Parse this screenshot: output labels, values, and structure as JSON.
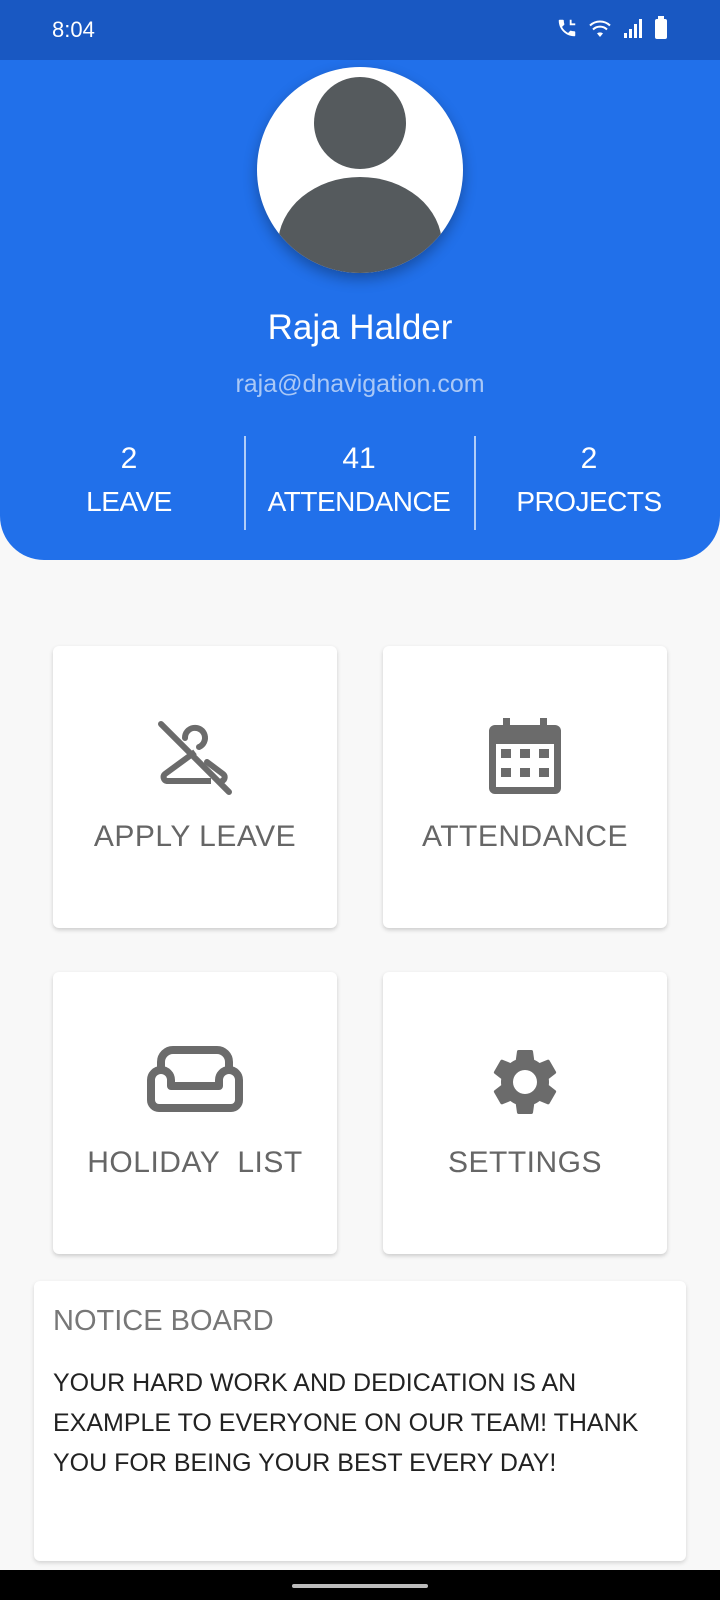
{
  "status_bar": {
    "time": "8:04",
    "icons": [
      "call-icon",
      "wifi-icon",
      "signal-icon",
      "battery-icon"
    ]
  },
  "profile": {
    "name": "Raja Halder",
    "email": "raja@dnavigation.com",
    "avatar_icon": "person-icon"
  },
  "stats": [
    {
      "value": "2",
      "label": "LEAVE"
    },
    {
      "value": "41",
      "label": "ATTENDANCE"
    },
    {
      "value": "2",
      "label": "PROJECTS"
    }
  ],
  "menu": {
    "apply_leave": {
      "label": "APPLY LEAVE",
      "icon": "no-hanger-icon"
    },
    "attendance": {
      "label": "ATTENDANCE",
      "icon": "calendar-icon"
    },
    "holiday_list": {
      "label": "HOLIDAY  LIST",
      "icon": "sofa-icon"
    },
    "settings": {
      "label": "SETTINGS",
      "icon": "gear-icon"
    }
  },
  "notice_board": {
    "title": "NOTICE BOARD",
    "message": "YOUR HARD WORK AND DEDICATION IS AN EXAMPLE TO EVERYONE ON OUR TEAM! THANK YOU FOR BEING YOUR BEST EVERY DAY!"
  },
  "colors": {
    "status_bar": "#1958c2",
    "header": "#2170ea",
    "background": "#f8f8f8",
    "icon_gray": "#6b6b6b"
  }
}
